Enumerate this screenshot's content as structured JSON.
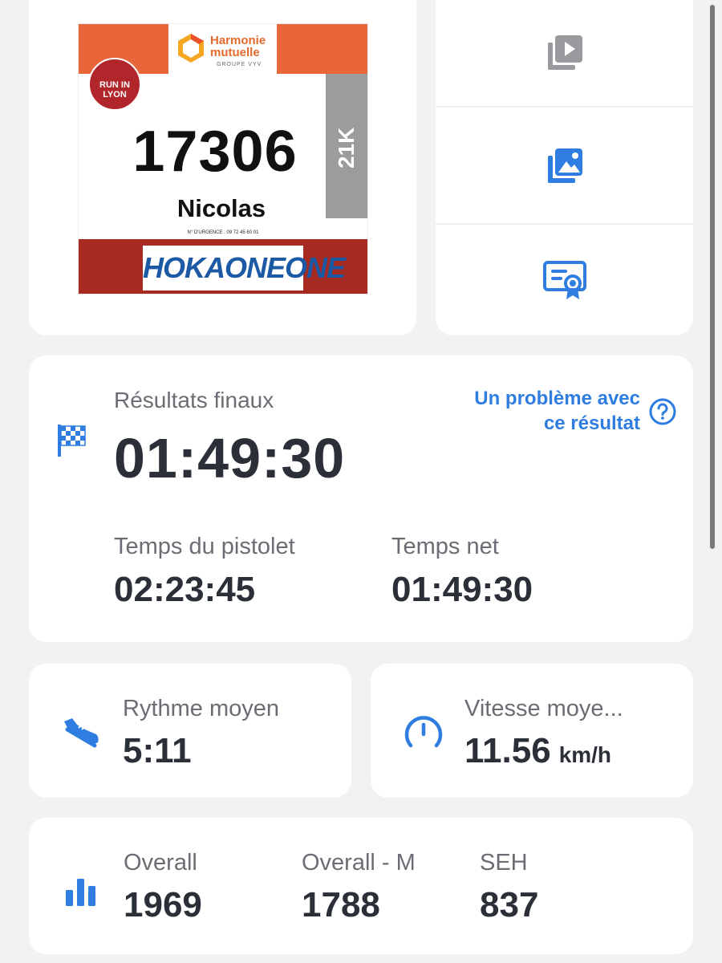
{
  "bib": {
    "sponsor_line1": "Harmonie",
    "sponsor_line2": "mutuelle",
    "sponsor_group": "GROUPE VYV",
    "event_logo": "RUN IN LYON",
    "distance": "21K",
    "number": "17306",
    "name": "Nicolas",
    "emergency": "N° D'URGENCE : 09 72 45 60 01",
    "bottom_sponsor": "HOKAONEONE"
  },
  "actions": [
    {
      "icon": "video-library-icon"
    },
    {
      "icon": "photo-library-icon"
    },
    {
      "icon": "certificate-icon"
    }
  ],
  "results": {
    "label": "Résultats finaux",
    "time": "01:49:30",
    "problem_link": "Un problème avec ce résultat",
    "gun_label": "Temps du pistolet",
    "gun_time": "02:23:45",
    "net_label": "Temps net",
    "net_time": "01:49:30"
  },
  "pace": {
    "label": "Rythme moyen",
    "value": "5:11"
  },
  "speed": {
    "label": "Vitesse moye...",
    "value": "11.56",
    "unit": "km/h"
  },
  "ranking": [
    {
      "label": "Overall",
      "value": "1969"
    },
    {
      "label": "Overall - M",
      "value": "1788"
    },
    {
      "label": "SEH",
      "value": "837"
    }
  ],
  "colors": {
    "accent": "#2f7de0",
    "icon_gray": "#9a9a9e",
    "text_dark": "#2b2f38",
    "text_muted": "#6a6d73",
    "background": "#f2f2f4"
  }
}
